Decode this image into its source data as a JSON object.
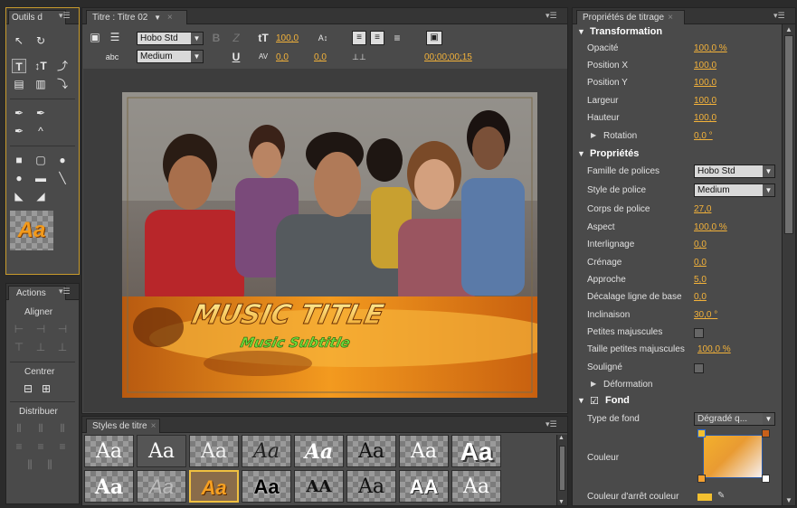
{
  "tools": {
    "tab": "Outils d",
    "icons": [
      "selection-arrow",
      "rotation",
      "type-horizontal",
      "type-vertical",
      "path-type",
      "area-type",
      "vertical-area-type",
      "path-type-vertical",
      "pen",
      "add-anchor",
      "delete-anchor",
      "convert-anchor",
      "rectangle",
      "rounded-rect",
      "ellipse",
      "rounded-corner",
      "clipped-corner",
      "line",
      "wedge",
      "arc"
    ],
    "preview_label": "Aa"
  },
  "actions": {
    "tab": "Actions",
    "aligner": "Aligner",
    "centrer": "Centrer",
    "distribuer": "Distribuer"
  },
  "main": {
    "tab": "Titre : Titre 02",
    "font_family": "Hobo Std",
    "font_style": "Medium",
    "bold": "B",
    "italic": "Z",
    "underline": "U",
    "font_size": "100,0",
    "kerning": "0,0",
    "leading": "0,0",
    "timecode": "00;00;00;15",
    "title_text": "MUSIC TITLE",
    "subtitle_text": "Music Subtitle"
  },
  "styles": {
    "tab": "Styles de titre",
    "row1": [
      "Aa",
      "Aa",
      "Aa",
      "Aa",
      "Aa",
      "Aa",
      "Aa",
      "Aa"
    ],
    "row2": [
      "Aa",
      "Aa",
      "Aa",
      "Aa",
      "AA",
      "Aa",
      "AA",
      "Aa"
    ]
  },
  "props": {
    "tab": "Propriétés de titrage",
    "transformation": "Transformation",
    "opacite": "Opacité",
    "opacite_v": "100,0 %",
    "posx": "Position X",
    "posx_v": "100,0",
    "posy": "Position Y",
    "posy_v": "100,0",
    "largeur": "Largeur",
    "largeur_v": "100,0",
    "hauteur": "Hauteur",
    "hauteur_v": "100,0",
    "rotation": "Rotation",
    "rotation_v": "0,0 °",
    "proprietes": "Propriétés",
    "famille": "Famille de polices",
    "famille_v": "Hobo Std",
    "style": "Style de police",
    "style_v": "Medium",
    "corps": "Corps de police",
    "corps_v": "27,0",
    "aspect": "Aspect",
    "aspect_v": "100,0 %",
    "interlignage": "Interlignage",
    "interlignage_v": "0,0",
    "crenage": "Crénage",
    "crenage_v": "0,0",
    "approche": "Approche",
    "approche_v": "5,0",
    "decalage": "Décalage ligne de base",
    "decalage_v": "0,0",
    "inclinaison": "Inclinaison",
    "inclinaison_v": "30,0 °",
    "petites": "Petites majuscules",
    "taille_petites": "Taille petites majuscules",
    "taille_petites_v": "100,0 %",
    "souligne": "Souligné",
    "deformation": "Déformation",
    "fond": "Fond",
    "type_fond": "Type de fond",
    "type_fond_v": "Dégradé q...",
    "couleur": "Couleur",
    "couleur_arret": "Couleur d'arrêt couleur"
  }
}
